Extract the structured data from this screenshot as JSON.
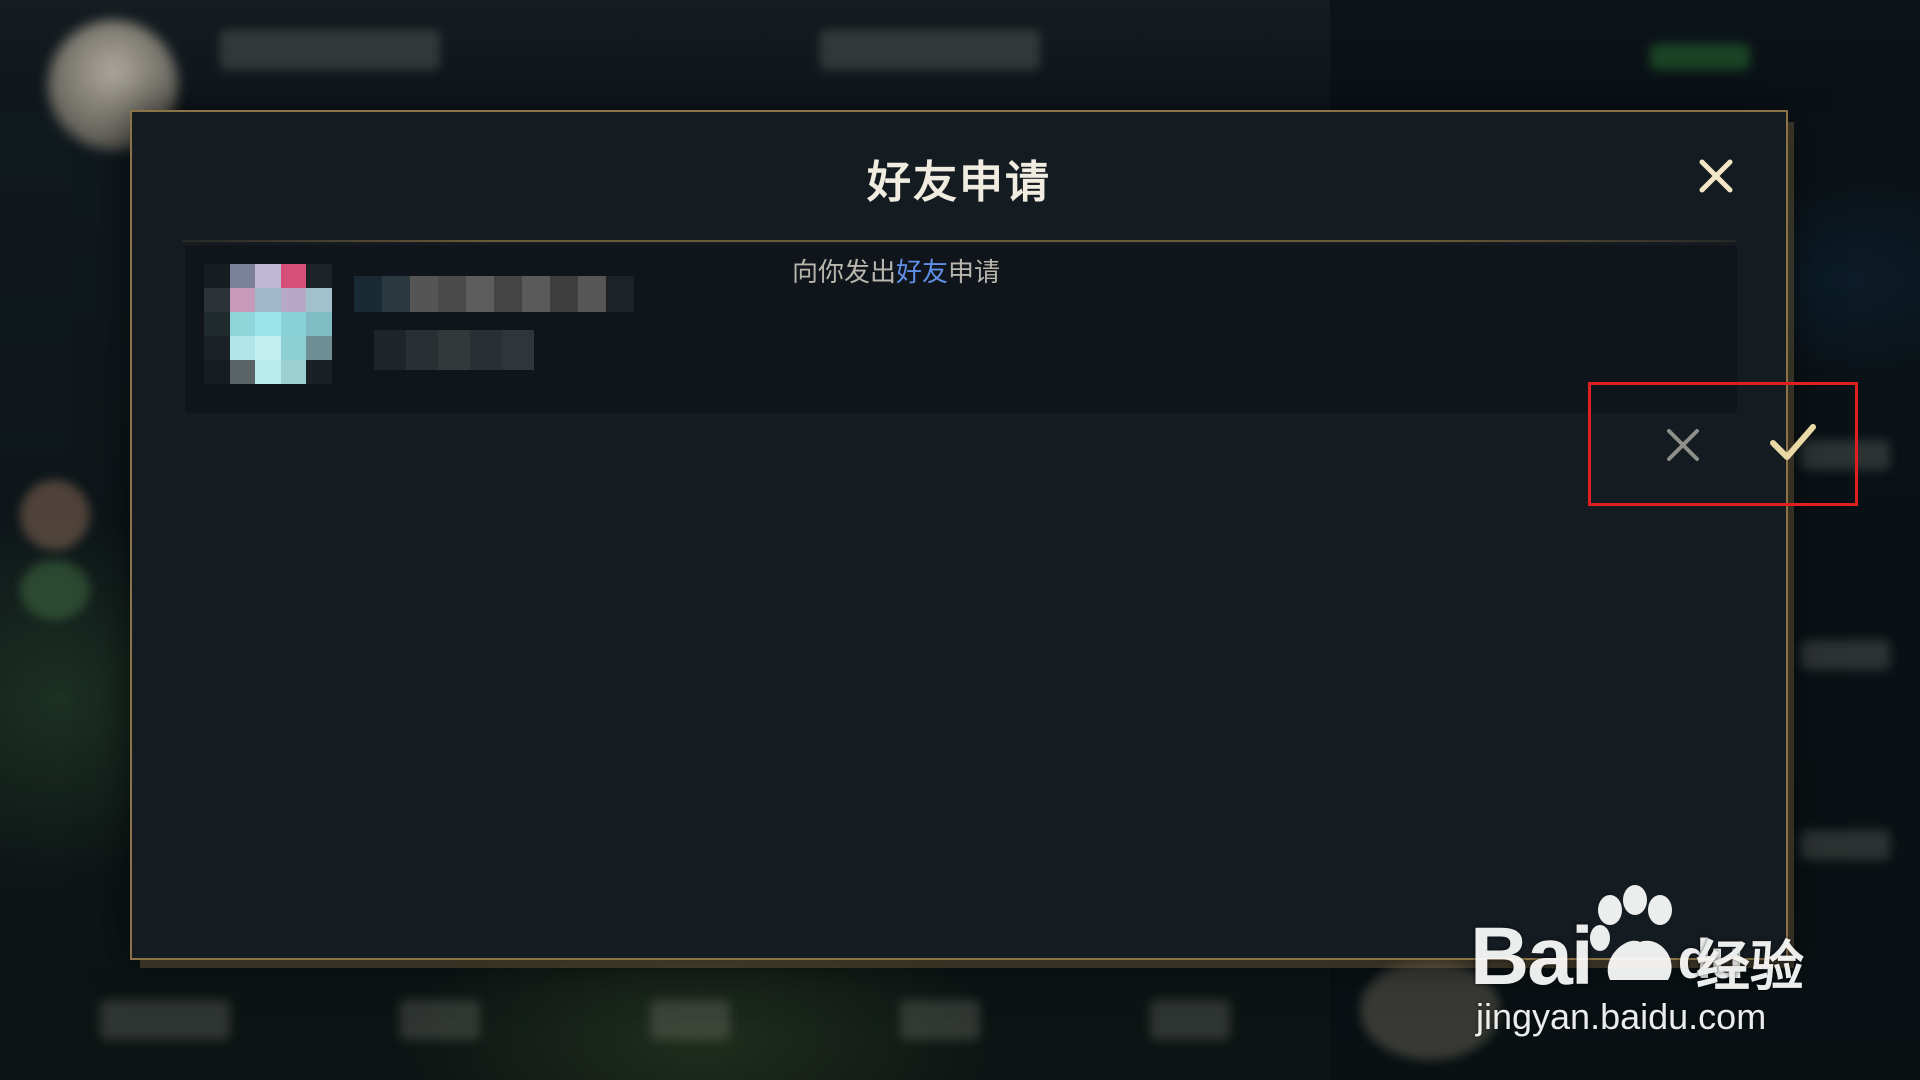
{
  "modal": {
    "title": "好友申请",
    "close_icon": "close-icon"
  },
  "request": {
    "avatar": "pixelated-avatar",
    "name_redacted": true,
    "message_prefix": "向你发出",
    "message_highlight": "好友",
    "message_suffix": "申请",
    "reject_icon": "x-icon",
    "accept_icon": "checkmark-icon"
  },
  "watermark": {
    "logo_text_left": "Bai",
    "logo_text_right": "du",
    "logo_cn": "经验",
    "url": "jingyan.baidu.com"
  },
  "colors": {
    "modal_border": "#8b7348",
    "modal_bg": "#141b21",
    "row_bg": "#0f151a",
    "title": "#f1ece0",
    "highlight_link": "#5f8fe6",
    "reject_icon": "#8e8e8a",
    "accept_icon": "#e8d9a6",
    "annotation_box": "#e02020"
  }
}
